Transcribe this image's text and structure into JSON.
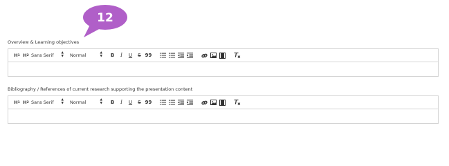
{
  "callout": {
    "number": "12",
    "color": "#b05fc8"
  },
  "fields": [
    {
      "label": "Overview & Learning objectives",
      "content": ""
    },
    {
      "label": "Bibliography / References of current research supporting the presentation content",
      "content": ""
    }
  ],
  "toolbar": {
    "h1": "H",
    "h1_sub": "1",
    "h2": "H",
    "h2_sub": "2",
    "font_value": "Sans Serif",
    "size_value": "Normal",
    "bold": "B",
    "italic": "I",
    "underline": "U",
    "strike": "S",
    "quote": "99"
  }
}
